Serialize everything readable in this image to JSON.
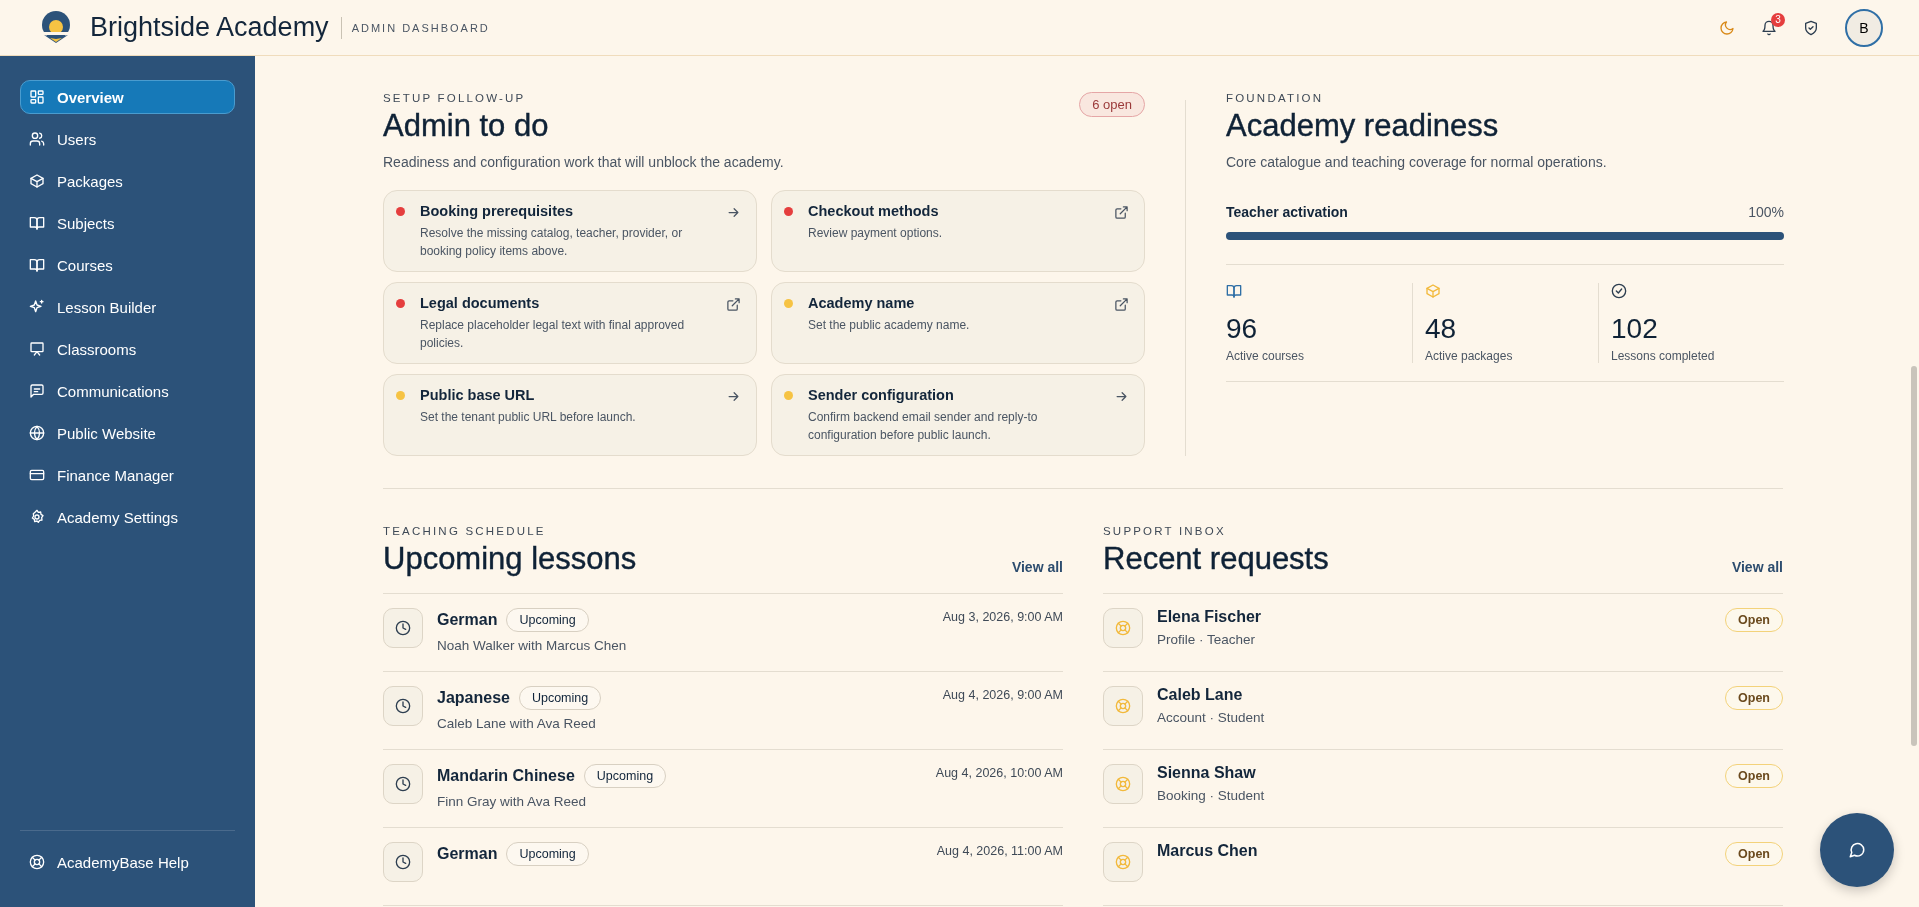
{
  "header": {
    "brand": "Brightside Academy",
    "subtitle": "ADMIN DASHBOARD",
    "notification_count": "3",
    "avatar_initial": "B"
  },
  "sidebar": {
    "items": [
      {
        "label": "Overview",
        "selected": true
      },
      {
        "label": "Users",
        "selected": false
      },
      {
        "label": "Packages",
        "selected": false
      },
      {
        "label": "Subjects",
        "selected": false
      },
      {
        "label": "Courses",
        "selected": false
      },
      {
        "label": "Lesson Builder",
        "selected": false
      },
      {
        "label": "Classrooms",
        "selected": false
      },
      {
        "label": "Communications",
        "selected": false
      },
      {
        "label": "Public Website",
        "selected": false
      },
      {
        "label": "Finance Manager",
        "selected": false
      },
      {
        "label": "Academy Settings",
        "selected": false
      }
    ],
    "footer_link": "AcademyBase Help"
  },
  "admin_todo": {
    "eyebrow": "SETUP FOLLOW-UP",
    "title": "Admin to do",
    "badge": "6 open",
    "description": "Readiness and configuration work that will unblock the academy.",
    "tasks": [
      {
        "title": "Booking prerequisites",
        "description": "Resolve the missing catalog, teacher, provider, or booking policy items above.",
        "color": "#e53e3e",
        "kind": "internal"
      },
      {
        "title": "Checkout methods",
        "description": "Review payment options.",
        "color": "#e53e3e",
        "kind": "external"
      },
      {
        "title": "Legal documents",
        "description": "Replace placeholder legal text with final approved policies.",
        "color": "#e53e3e",
        "kind": "external"
      },
      {
        "title": "Academy name",
        "description": "Set the public academy name.",
        "color": "#f6c343",
        "kind": "external"
      },
      {
        "title": "Public base URL",
        "description": "Set the tenant public URL before launch.",
        "color": "#f6c343",
        "kind": "internal"
      },
      {
        "title": "Sender configuration",
        "description": "Confirm backend email sender and reply-to configuration before public launch.",
        "color": "#f6c343",
        "kind": "internal"
      }
    ]
  },
  "readiness": {
    "eyebrow": "FOUNDATION",
    "title": "Academy readiness",
    "description": "Core catalogue and teaching coverage for normal operations.",
    "progress": {
      "label": "Teacher activation",
      "reading": "100%",
      "level": 1
    },
    "stats": [
      {
        "value": "96",
        "label": "Active courses"
      },
      {
        "value": "48",
        "label": "Active packages"
      },
      {
        "value": "102",
        "label": "Lessons completed"
      }
    ]
  },
  "lessons": {
    "eyebrow": "TEACHING SCHEDULE",
    "title": "Upcoming lessons",
    "view_all": "View all",
    "rows": [
      {
        "subject": "German",
        "status": "Upcoming",
        "people": "Noah Walker with Marcus Chen",
        "time": "Aug 3, 2026, 9:00 AM"
      },
      {
        "subject": "Japanese",
        "status": "Upcoming",
        "people": "Caleb Lane with Ava Reed",
        "time": "Aug 4, 2026, 9:00 AM"
      },
      {
        "subject": "Mandarin Chinese",
        "status": "Upcoming",
        "people": "Finn Gray with Ava Reed",
        "time": "Aug 4, 2026, 10:00 AM"
      },
      {
        "subject": "German",
        "status": "Upcoming",
        "time": "Aug 4, 2026, 11:00 AM"
      }
    ]
  },
  "requests": {
    "eyebrow": "SUPPORT INBOX",
    "title": "Recent requests",
    "view_all": "View all",
    "rows": [
      {
        "name": "Elena Fischer",
        "meta": "Profile · Teacher",
        "status": "Open"
      },
      {
        "name": "Caleb Lane",
        "meta": "Account · Student",
        "status": "Open"
      },
      {
        "name": "Sienna Shaw",
        "meta": "Booking · Student",
        "status": "Open"
      },
      {
        "name": "Marcus Chen",
        "status": "Open"
      }
    ]
  }
}
